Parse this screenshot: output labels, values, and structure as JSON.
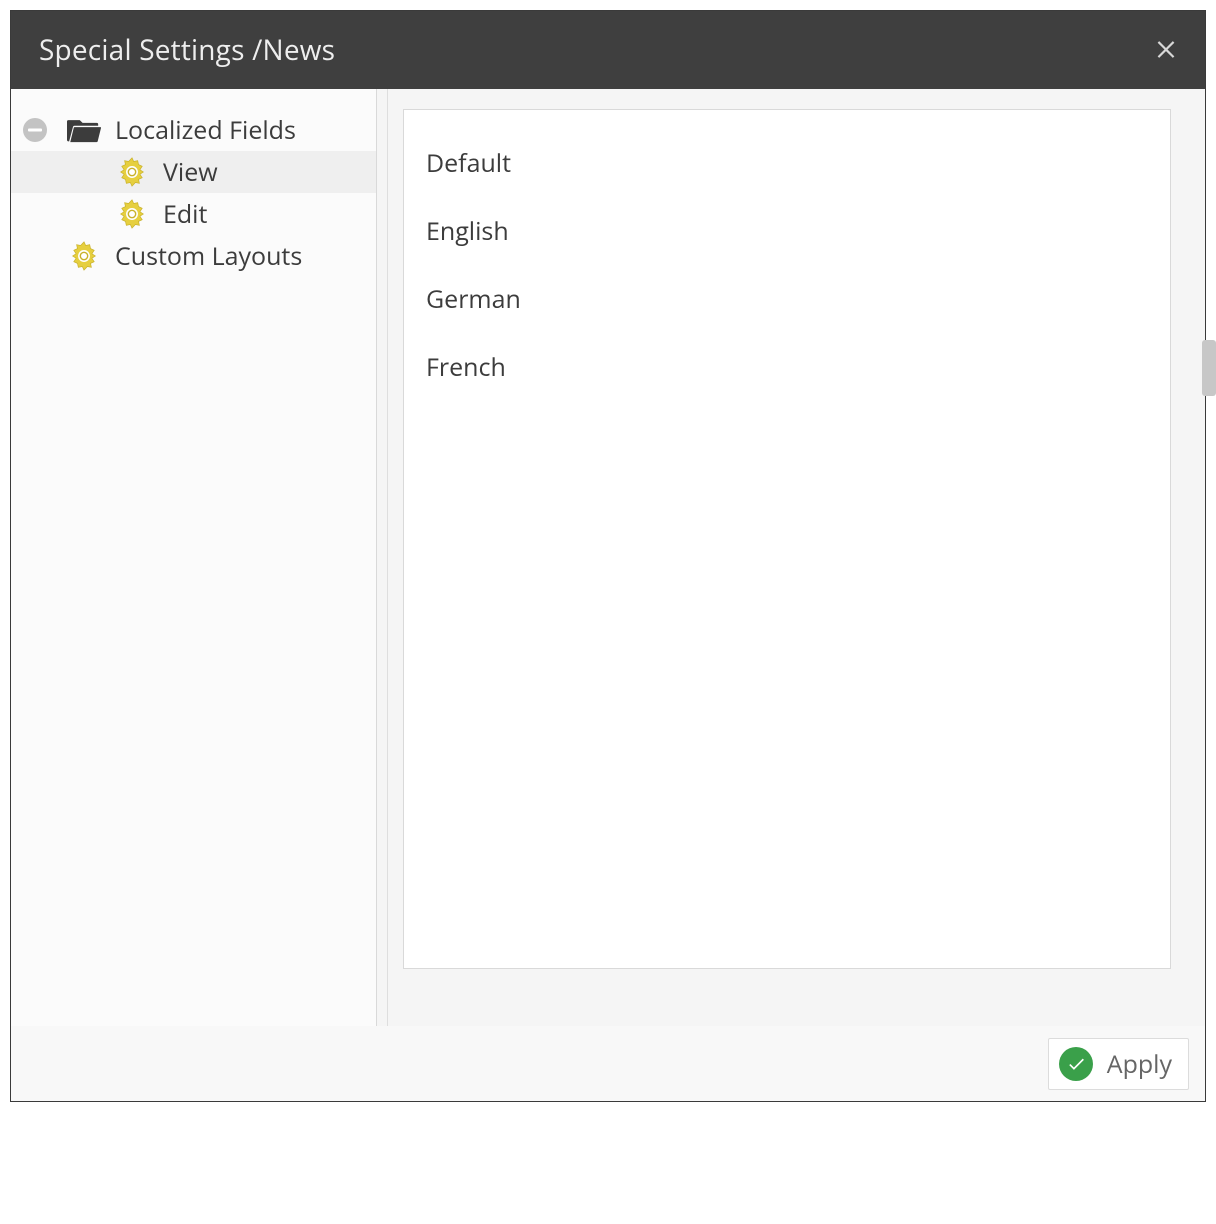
{
  "dialog": {
    "title": "Special Settings /News"
  },
  "sidebar": {
    "items": [
      {
        "label": "Localized Fields",
        "icon": "folder",
        "indent": 0,
        "toggle": true,
        "selected": false
      },
      {
        "label": "View",
        "icon": "gear",
        "indent": 1,
        "toggle": false,
        "selected": true
      },
      {
        "label": "Edit",
        "icon": "gear",
        "indent": 1,
        "toggle": false,
        "selected": false
      },
      {
        "label": "Custom Layouts",
        "icon": "gear",
        "indent": 0,
        "toggle": false,
        "selected": false
      }
    ]
  },
  "main": {
    "languages": [
      "Default",
      "English",
      "German",
      "French"
    ]
  },
  "footer": {
    "apply_label": "Apply"
  }
}
